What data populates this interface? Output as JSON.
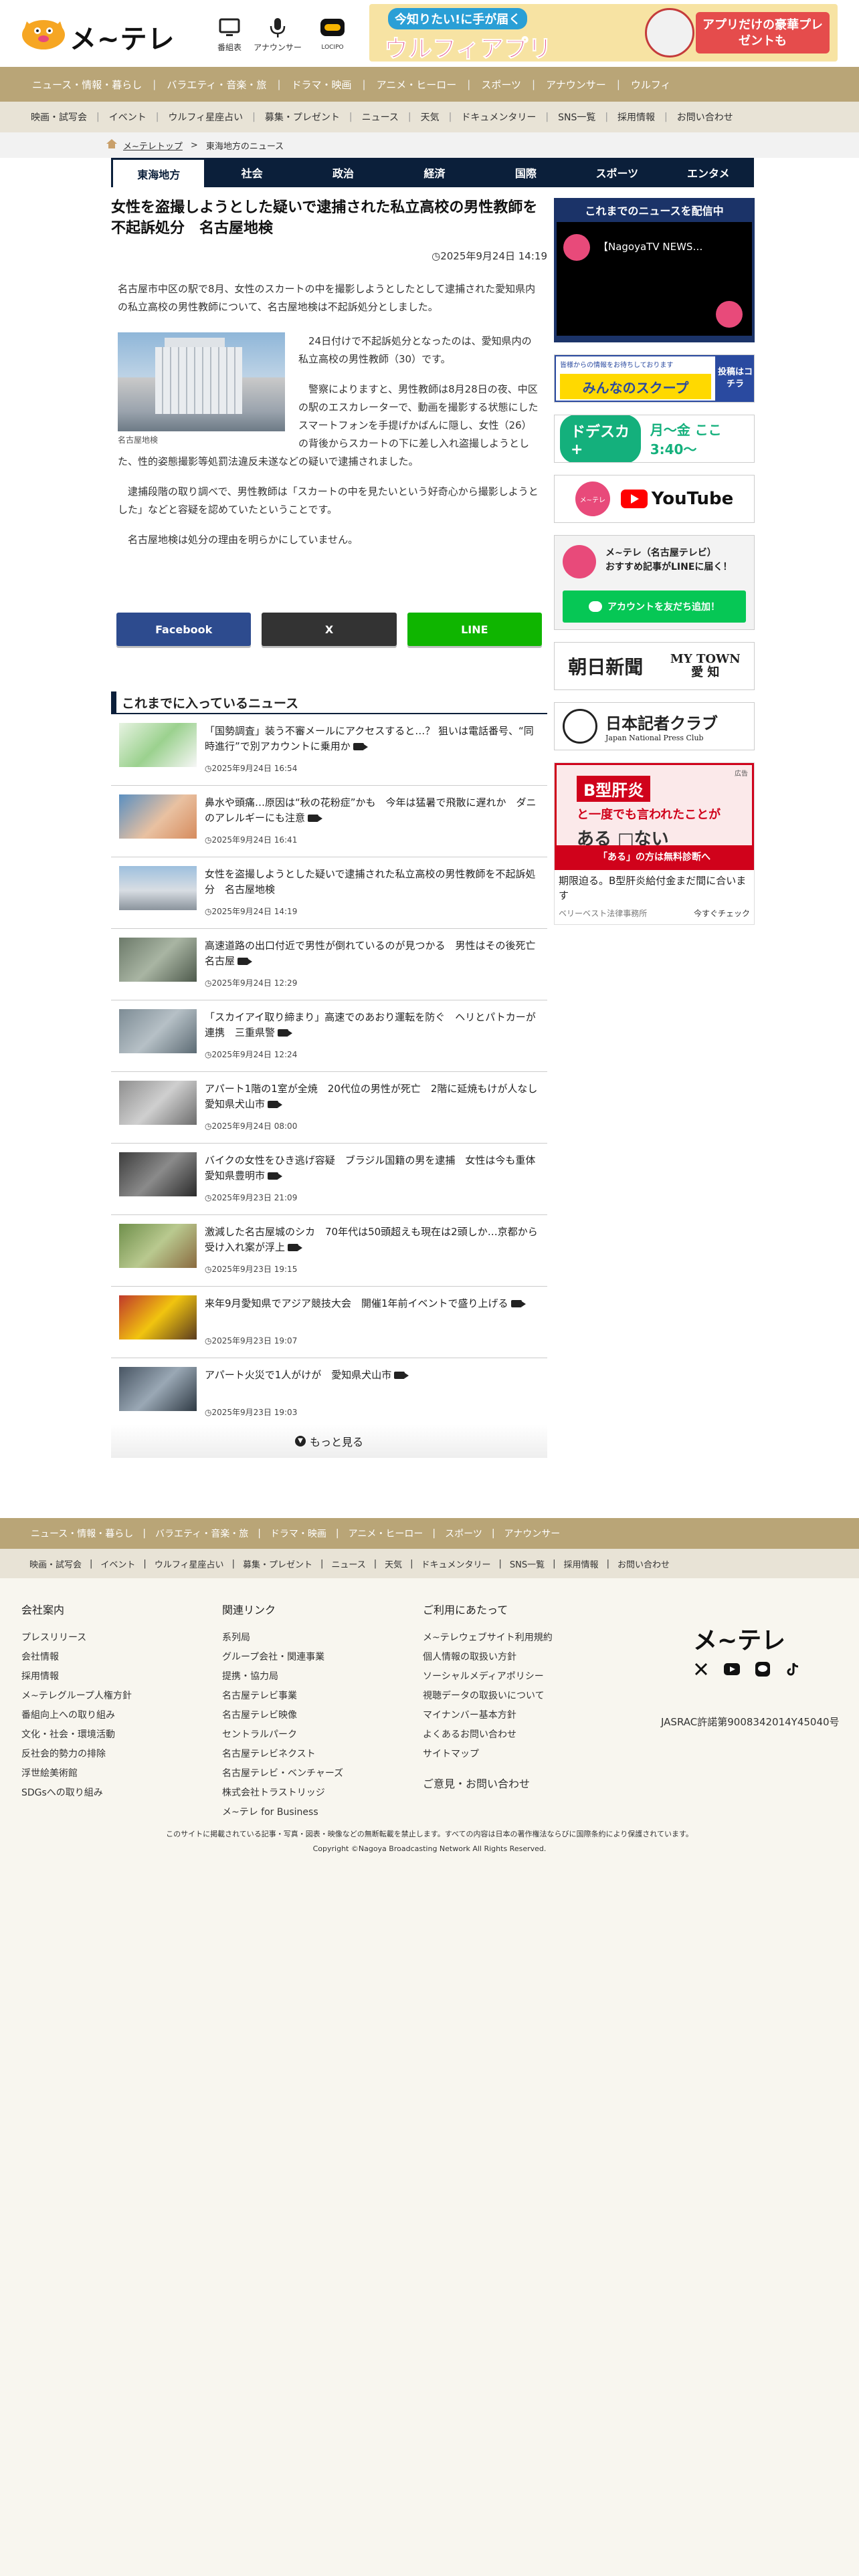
{
  "header": {
    "logo_text": "メ~テレ",
    "icons": [
      {
        "label": "番組表",
        "icon": "tv-icon"
      },
      {
        "label": "アナウンサー",
        "icon": "microphone-icon"
      },
      {
        "label": "LOCIPO",
        "icon": "locipo-icon"
      }
    ],
    "app_banner": {
      "small": "今知りたい!に手が届く",
      "big": "ウルフィアプリ",
      "right": "アプリだけの豪華プレゼントも"
    }
  },
  "nav1": [
    "ニュース・情報・暮らし",
    "バラエティ・音楽・旅",
    "ドラマ・映画",
    "アニメ・ヒーロー",
    "スポーツ",
    "アナウンサー",
    "ウルフィ"
  ],
  "nav2": [
    "映画・試写会",
    "イベント",
    "ウルフィ星座占い",
    "募集・プレゼント",
    "ニュース",
    "天気",
    "ドキュメンタリー",
    "SNS一覧",
    "採用情報",
    "お問い合わせ"
  ],
  "breadcrumb": {
    "home": "メ~テレトップ",
    "current": "東海地方のニュース"
  },
  "tabs": [
    "東海地方",
    "社会",
    "政治",
    "経済",
    "国際",
    "スポーツ",
    "エンタメ"
  ],
  "article": {
    "title": "女性を盗撮しようとした疑いで逮捕された私立高校の男性教師を不起訴処分　名古屋地検",
    "date": "2025年9月24日 14:19",
    "lead": "名古屋市中区の駅で8月、女性のスカートの中を撮影しようとしたとして逮捕された愛知県内の私立高校の男性教師について、名古屋地検は不起訴処分としました。",
    "caption": "名古屋地検",
    "p1": "24日付けで不起訴処分となったのは、愛知県内の私立高校の男性教師（30）です。",
    "p2": "警察によりますと、男性教師は8月28日の夜、中区の駅のエスカレーターで、動画を撮影する状態にしたスマートフォンを手提げかばんに隠し、女性（26）の背後からスカートの下に差し入れ盗撮しようとした、性的姿態撮影等処罰法違反未遂などの疑いで逮捕されました。",
    "p3": "逮捕段階の取り調べで、男性教師は「スカートの中を見たいという好奇心から撮影しようとした」などと容疑を認めていたということです。",
    "p4": "名古屋地検は処分の理由を明らかにしていません。"
  },
  "share": {
    "facebook": "Facebook",
    "x": "X",
    "line": "LINE"
  },
  "news_head": "これまでに入っているニュース",
  "news": [
    {
      "title": "「国勢調査」装う不審メールにアクセスすると…？ 狙いは電話番号、“同時進行”で別アカウントに乗用か",
      "date": "2025年9月24日 16:54",
      "video": true
    },
    {
      "title": "鼻水や頭痛…原因は“秋の花粉症”かも　今年は猛暑で飛散に遅れか　ダニのアレルギーにも注意",
      "date": "2025年9月24日 16:41",
      "video": true
    },
    {
      "title": "女性を盗撮しようとした疑いで逮捕された私立高校の男性教師を不起訴処分　名古屋地検",
      "date": "2025年9月24日 14:19",
      "video": false
    },
    {
      "title": "高速道路の出口付近で男性が倒れているのが見つかる　男性はその後死亡　名古屋",
      "date": "2025年9月24日 12:29",
      "video": true
    },
    {
      "title": "「スカイアイ取り締まり」高速でのあおり運転を防ぐ　ヘリとパトカーが連携　三重県警",
      "date": "2025年9月24日 12:24",
      "video": true
    },
    {
      "title": "アパート1階の1室が全焼　20代位の男性が死亡　2階に延焼もけが人なし　愛知県犬山市",
      "date": "2025年9月24日 08:00",
      "video": true
    },
    {
      "title": "バイクの女性をひき逃げ容疑　ブラジル国籍の男を逮捕　女性は今も重体　愛知県豊明市",
      "date": "2025年9月23日 21:09",
      "video": true
    },
    {
      "title": "激減した名古屋城のシカ　70年代は50頭超えも現在は2頭しか…京都から受け入れ案が浮上",
      "date": "2025年9月23日 19:15",
      "video": true
    },
    {
      "title": "来年9月愛知県でアジア競技大会　開催1年前イベントで盛り上げる",
      "date": "2025年9月23日 19:07",
      "video": true
    },
    {
      "title": "アパート火災で1人がけが　愛知県犬山市",
      "date": "2025年9月23日 19:03",
      "video": true
    }
  ],
  "more_label": "もっと見る",
  "side": {
    "live_head": "これまでのニュースを配信中",
    "live_title": "【NagoyaTV NEWS…",
    "scoop_small": "皆様からの情報をお待ちしております",
    "scoop_main": "みんなのスクープ",
    "scoop_right": "投稿はコチラ",
    "doraka_main": "ドデスカ+",
    "doraka_time": "月～金 ここ3:40～",
    "yt_circle": "メ~テレ",
    "yt_label": "YouTube",
    "line_text1": "メ~テレ（名古屋テレビ）",
    "line_text2": "おすすめ記事がLINEに届く！",
    "line_add": "アカウントを友だち追加！",
    "asahi": "朝日新聞",
    "mytown1": "MY TOWN",
    "mytown2": "愛 知",
    "press_jp": "日本記者クラブ",
    "press_en": "Japan National Press Club",
    "ad_tag": "広告",
    "ad_hl": "B型肝炎",
    "ad_hl2": "と一度でも言われたことが",
    "ad_hl3": "ある □ない",
    "ad_ftr": "「ある」の方は無料診断へ",
    "ad_text": "期限迫る。B型肝炎給付金まだ間に合います",
    "ad_source": "ベリーベスト法律事務所",
    "ad_cta": "今すぐチェック"
  },
  "footer_nav1": [
    "ニュース・情報・暮らし",
    "バラエティ・音楽・旅",
    "ドラマ・映画",
    "アニメ・ヒーロー",
    "スポーツ",
    "アナウンサー"
  ],
  "footer_nav2": [
    "映画・試写会",
    "イベント",
    "ウルフィ星座占い",
    "募集・プレゼント",
    "ニュース",
    "天気",
    "ドキュメンタリー",
    "SNS一覧",
    "採用情報",
    "お問い合わせ"
  ],
  "footer": {
    "col1": {
      "head": "会社案内",
      "items": [
        "プレスリリース",
        "会社情報",
        "採用情報",
        "メ~テレグループ人権方針",
        "番組向上への取り組み",
        "文化・社会・環境活動",
        "反社会的勢力の排除",
        "浮世絵美術館",
        "SDGsへの取り組み"
      ]
    },
    "col2": {
      "head": "関連リンク",
      "items": [
        "系列局",
        "グループ会社・関連事業",
        "提携・協力局",
        "名古屋テレビ事業",
        "名古屋テレビ映像",
        "セントラルパーク",
        "名古屋テレビネクスト",
        "名古屋テレビ・ベンチャーズ",
        "株式会社トラストリッジ",
        "メ~テレ for Business"
      ]
    },
    "col3": {
      "head": "ご利用にあたって",
      "items": [
        "メ~テレウェブサイト利用規約",
        "個人情報の取扱い方針",
        "ソーシャルメディアポリシー",
        "視聴データの取扱いについて",
        "マイナンバー基本方針",
        "よくあるお問い合わせ",
        "サイトマップ"
      ],
      "sub": "ご意見・お問い合わせ"
    },
    "logo": "メ~テレ",
    "social": [
      "x-icon",
      "youtube-icon",
      "line-icon",
      "tiktok-icon"
    ],
    "jasrac": "JASRAC許諾第9008342014Y45040号",
    "copy1": "このサイトに掲載されている記事・写真・図表・映像などの無断転載を禁止します。すべての内容は日本の著作権法ならびに国際条約により保護されています。",
    "copy2": "Copyright ©Nagoya Broadcasting Network All Rights Reserved."
  }
}
